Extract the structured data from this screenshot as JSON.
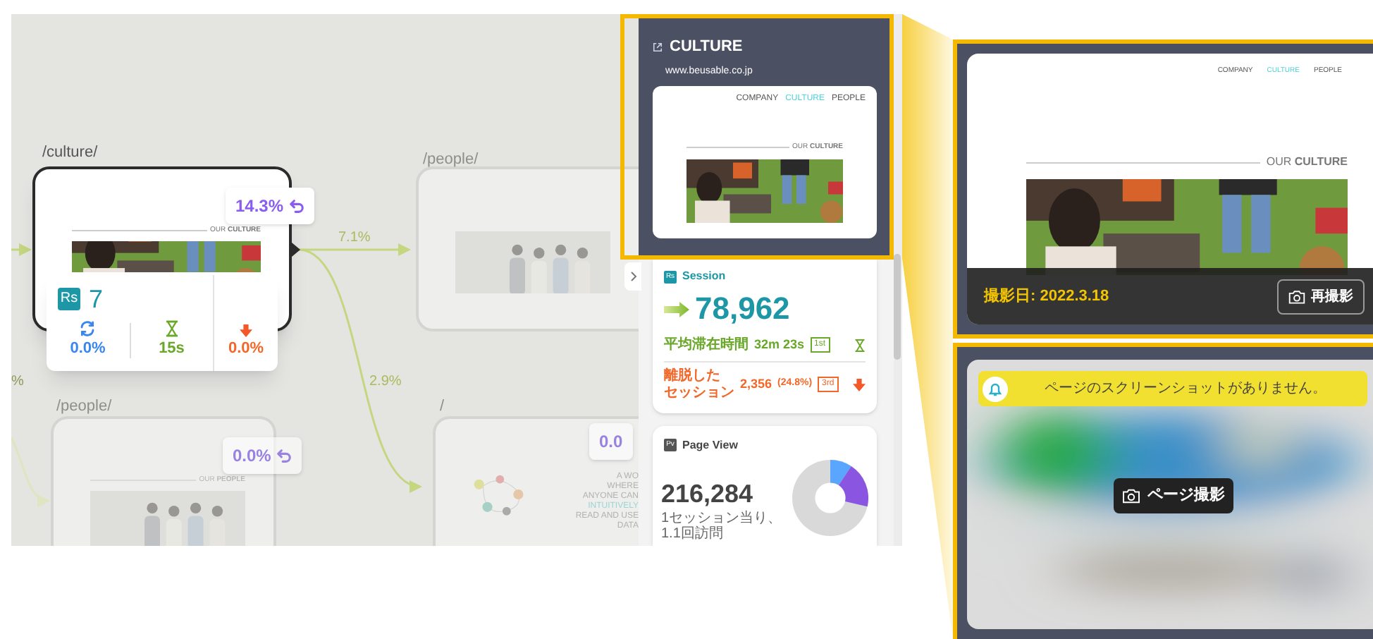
{
  "canvas": {
    "nodes": [
      {
        "path": "/culture/",
        "selected": true,
        "heading": "OUR **CULTURE**",
        "return_rate": "14.3%"
      },
      {
        "path": "/people/",
        "selected": false
      },
      {
        "path": "/people/",
        "selected": false,
        "heading": "OUR **PEOPLE**",
        "return_rate": "0.0%"
      },
      {
        "path": "/",
        "selected": false,
        "return_rate": "0.0",
        "tagline": [
          {
            "text": "A WO",
            "accent": false
          },
          {
            "text": "WHERE",
            "accent": false
          },
          {
            "text": "ANYONE CAN",
            "accent": false
          },
          {
            "text": "INTUITIVELY",
            "accent": true
          },
          {
            "text": "READ AND USE",
            "accent": false
          },
          {
            "text": "DATA",
            "accent": false
          }
        ]
      }
    ],
    "edges": [
      {
        "label": "7.1%",
        "highlighted": true
      },
      {
        "label": "2.9%",
        "highlighted": true
      },
      {
        "label": "%",
        "highlighted": false
      }
    ],
    "stats_card": {
      "badge": "Rs",
      "sessions": "7",
      "revisit": "0.0%",
      "duration": "15s",
      "exit": "0.0%"
    }
  },
  "panel": {
    "title": "CULTURE",
    "url": "www.beusable.co.jp",
    "thumbnail": {
      "nav": [
        {
          "label": "COMPANY",
          "selected": false
        },
        {
          "label": "CULTURE",
          "selected": true
        },
        {
          "label": "PEOPLE",
          "selected": false
        }
      ],
      "heading": "OUR **CULTURE**"
    },
    "session": {
      "badge": "Rs",
      "title": "Session",
      "total": "78,962",
      "metrics": [
        {
          "kind": "duration",
          "label_lines": [
            "平均滞在時間"
          ],
          "value": "32m 23s",
          "rank": "1st"
        },
        {
          "kind": "exit",
          "label_lines": [
            "離脱した",
            "セッション"
          ],
          "value": "2,356",
          "share": "(24.8%)",
          "rank": "3rd"
        }
      ]
    },
    "page_view": {
      "badge": "Pv",
      "title": "Page View",
      "total": "216,284",
      "note": "1セッション当り、\n1.1回訪問"
    }
  },
  "callouts": {
    "screenshot": {
      "nav": [
        {
          "label": "COMPANY",
          "selected": false
        },
        {
          "label": "CULTURE",
          "selected": true
        },
        {
          "label": "PEOPLE",
          "selected": false
        }
      ],
      "heading": "OUR **CULTURE**",
      "date": "撮影日: 2022.3.18",
      "retake": "再撮影"
    },
    "missing": {
      "message": "ページのスクリーンショットがありません。",
      "button": "ページ撮影"
    }
  }
}
